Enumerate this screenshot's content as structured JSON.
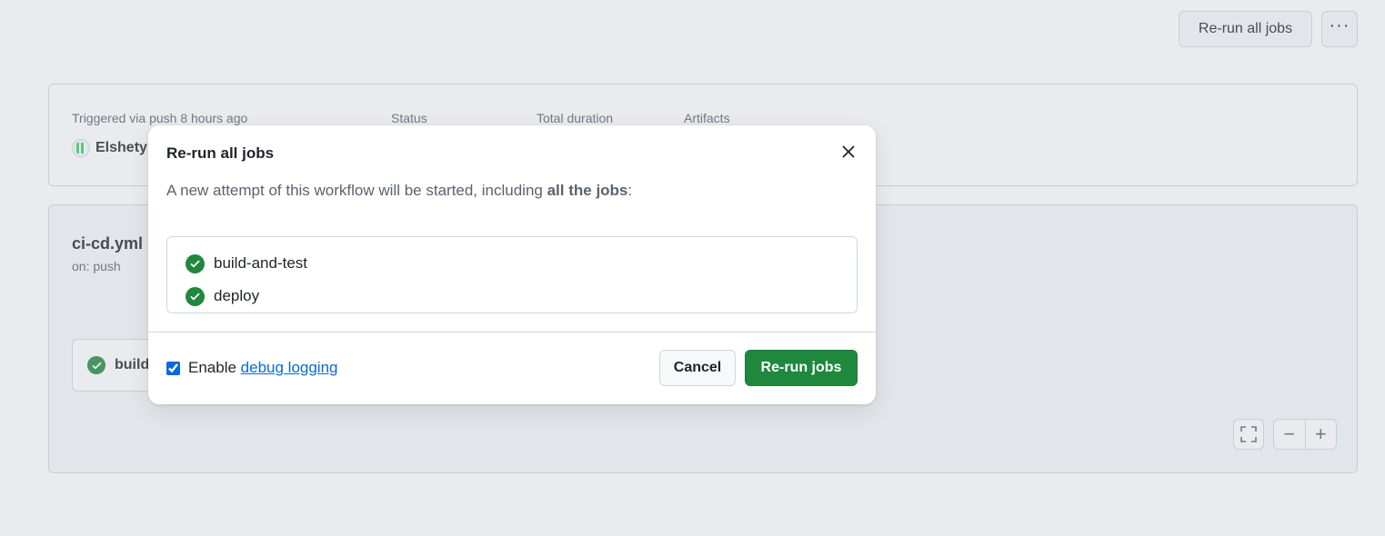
{
  "header": {
    "rerun_all_label": "Re-run all jobs",
    "more_label": "···"
  },
  "summary": {
    "triggered_label": "Triggered via push 8 hours ago",
    "status_label": "Status",
    "duration_label": "Total duration",
    "artifacts_label": "Artifacts",
    "actor": "Elshety"
  },
  "workflow": {
    "name": "ci-cd.yml",
    "trigger": "on: push",
    "job_node_label": "build",
    "controls": {
      "fullscreen": "⛶",
      "zoom_out": "−",
      "zoom_in": "+"
    }
  },
  "dialog": {
    "title": "Re-run all jobs",
    "close_icon": "close-icon",
    "description_prefix": "A new attempt of this workflow will be started, including ",
    "description_bold": "all the jobs",
    "description_suffix": ":",
    "jobs": [
      "build-and-test",
      "deploy"
    ],
    "debug_checkbox_checked": true,
    "debug_label_prefix": "Enable ",
    "debug_link": "debug logging",
    "cancel_label": "Cancel",
    "confirm_label": "Re-run jobs"
  },
  "colors": {
    "success": "#1f883d",
    "link": "#0969da",
    "border": "#d0d7de"
  }
}
